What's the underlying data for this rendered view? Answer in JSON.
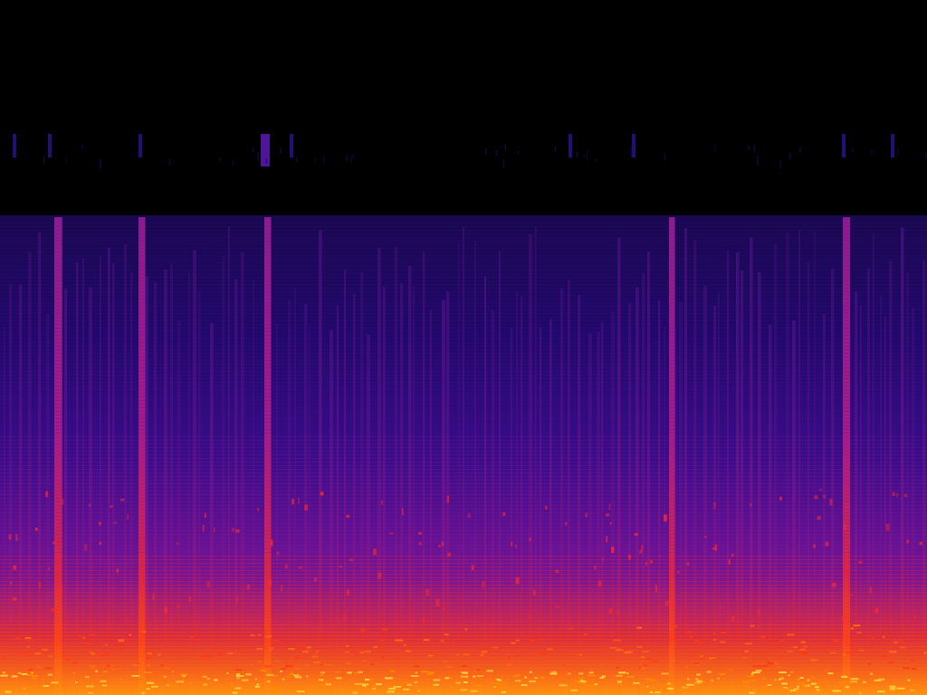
{
  "image": {
    "kind": "spectrogram",
    "colormap": "inferno-like",
    "background_color": "#000000",
    "palette": [
      "#000000",
      "#14083a",
      "#2a0a78",
      "#5a0f9a",
      "#9a1a9a",
      "#d8204a",
      "#ff3a14",
      "#ff8a00",
      "#ffd23a"
    ]
  }
}
